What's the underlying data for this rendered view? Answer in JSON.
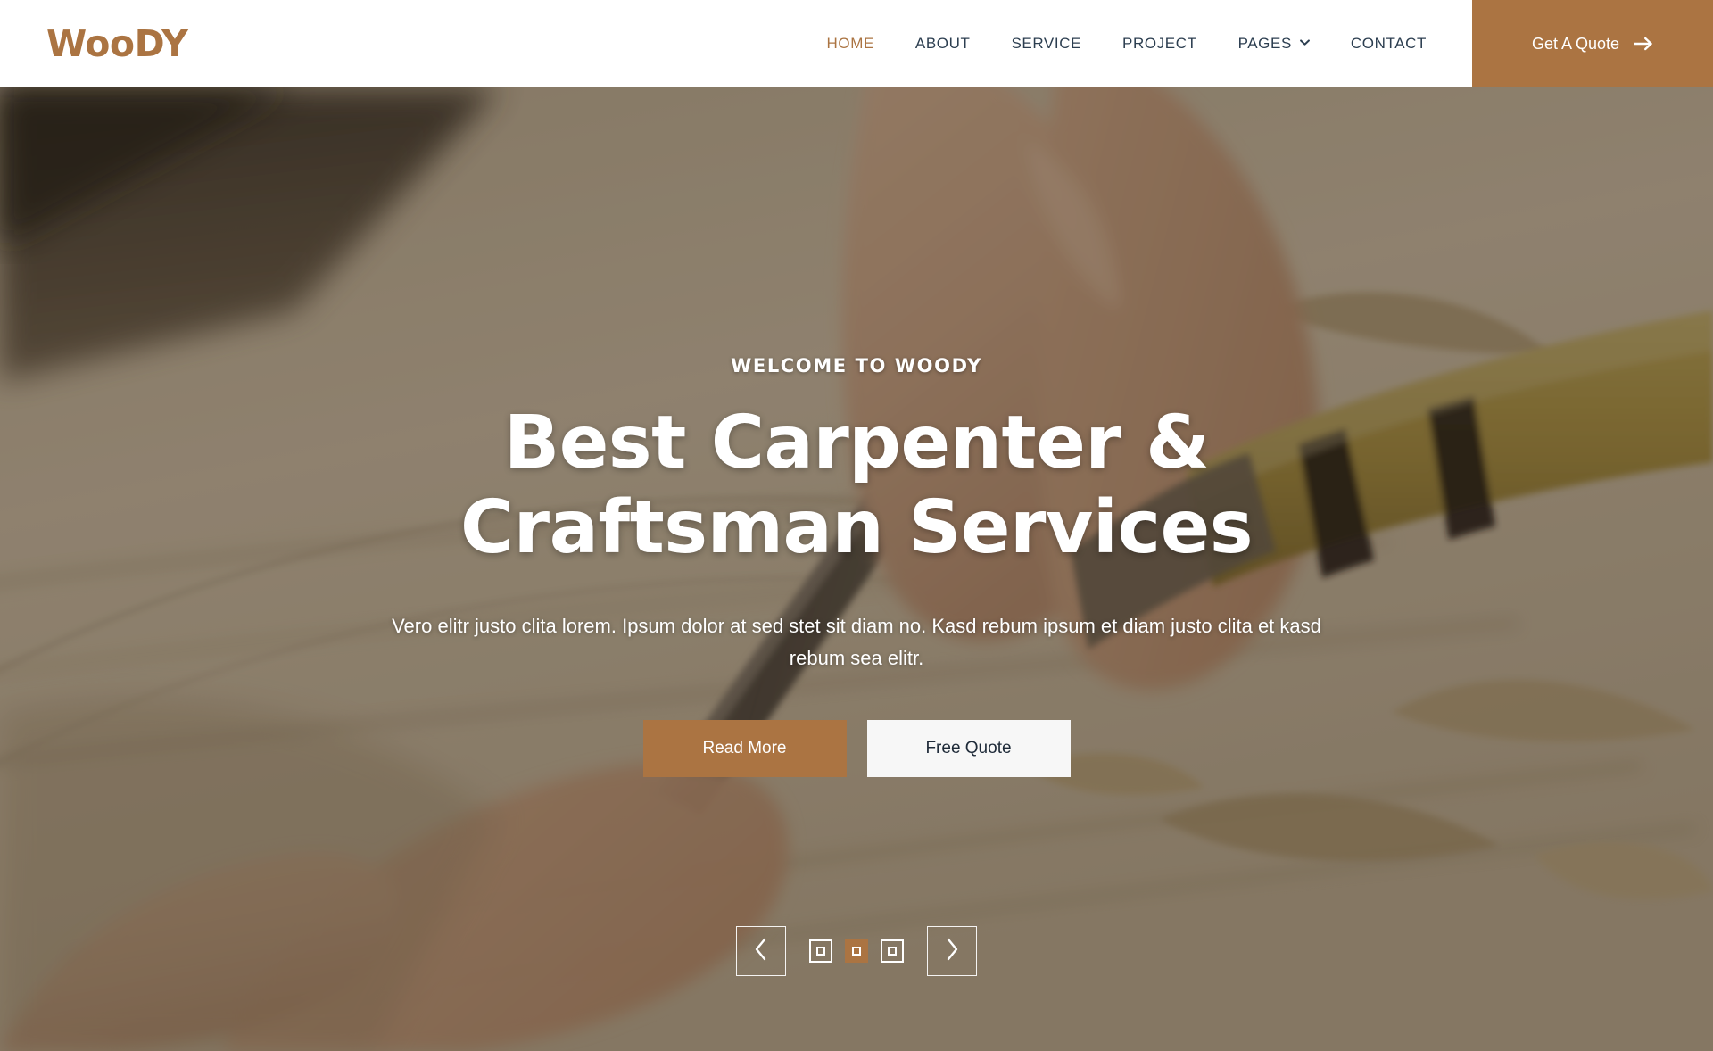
{
  "brand": {
    "logo_text": "WooDY",
    "accent_color": "#AB7442",
    "nav_text_color": "#2C3E50"
  },
  "header": {
    "nav": [
      {
        "label": "HOME",
        "active": true,
        "has_dropdown": false
      },
      {
        "label": "ABOUT",
        "active": false,
        "has_dropdown": false
      },
      {
        "label": "SERVICE",
        "active": false,
        "has_dropdown": false
      },
      {
        "label": "PROJECT",
        "active": false,
        "has_dropdown": false
      },
      {
        "label": "PAGES",
        "active": false,
        "has_dropdown": true
      },
      {
        "label": "CONTACT",
        "active": false,
        "has_dropdown": false
      }
    ],
    "cta": {
      "label": "Get A Quote",
      "icon": "arrow-right-icon"
    }
  },
  "hero": {
    "eyebrow": "WELCOME TO WOODY",
    "title": "Best Carpenter & Craftsman Services",
    "subtitle": "Vero elitr justo clita lorem. Ipsum dolor at sed stet sit diam no. Kasd rebum ipsum et diam justo clita et kasd rebum sea elitr.",
    "primary_button": "Read More",
    "secondary_button": "Free Quote",
    "background_description": "carpenter hand carving wood with chisel"
  },
  "carousel": {
    "prev_icon": "chevron-left-icon",
    "next_icon": "chevron-right-icon",
    "slide_count": 3,
    "active_slide": 2
  }
}
